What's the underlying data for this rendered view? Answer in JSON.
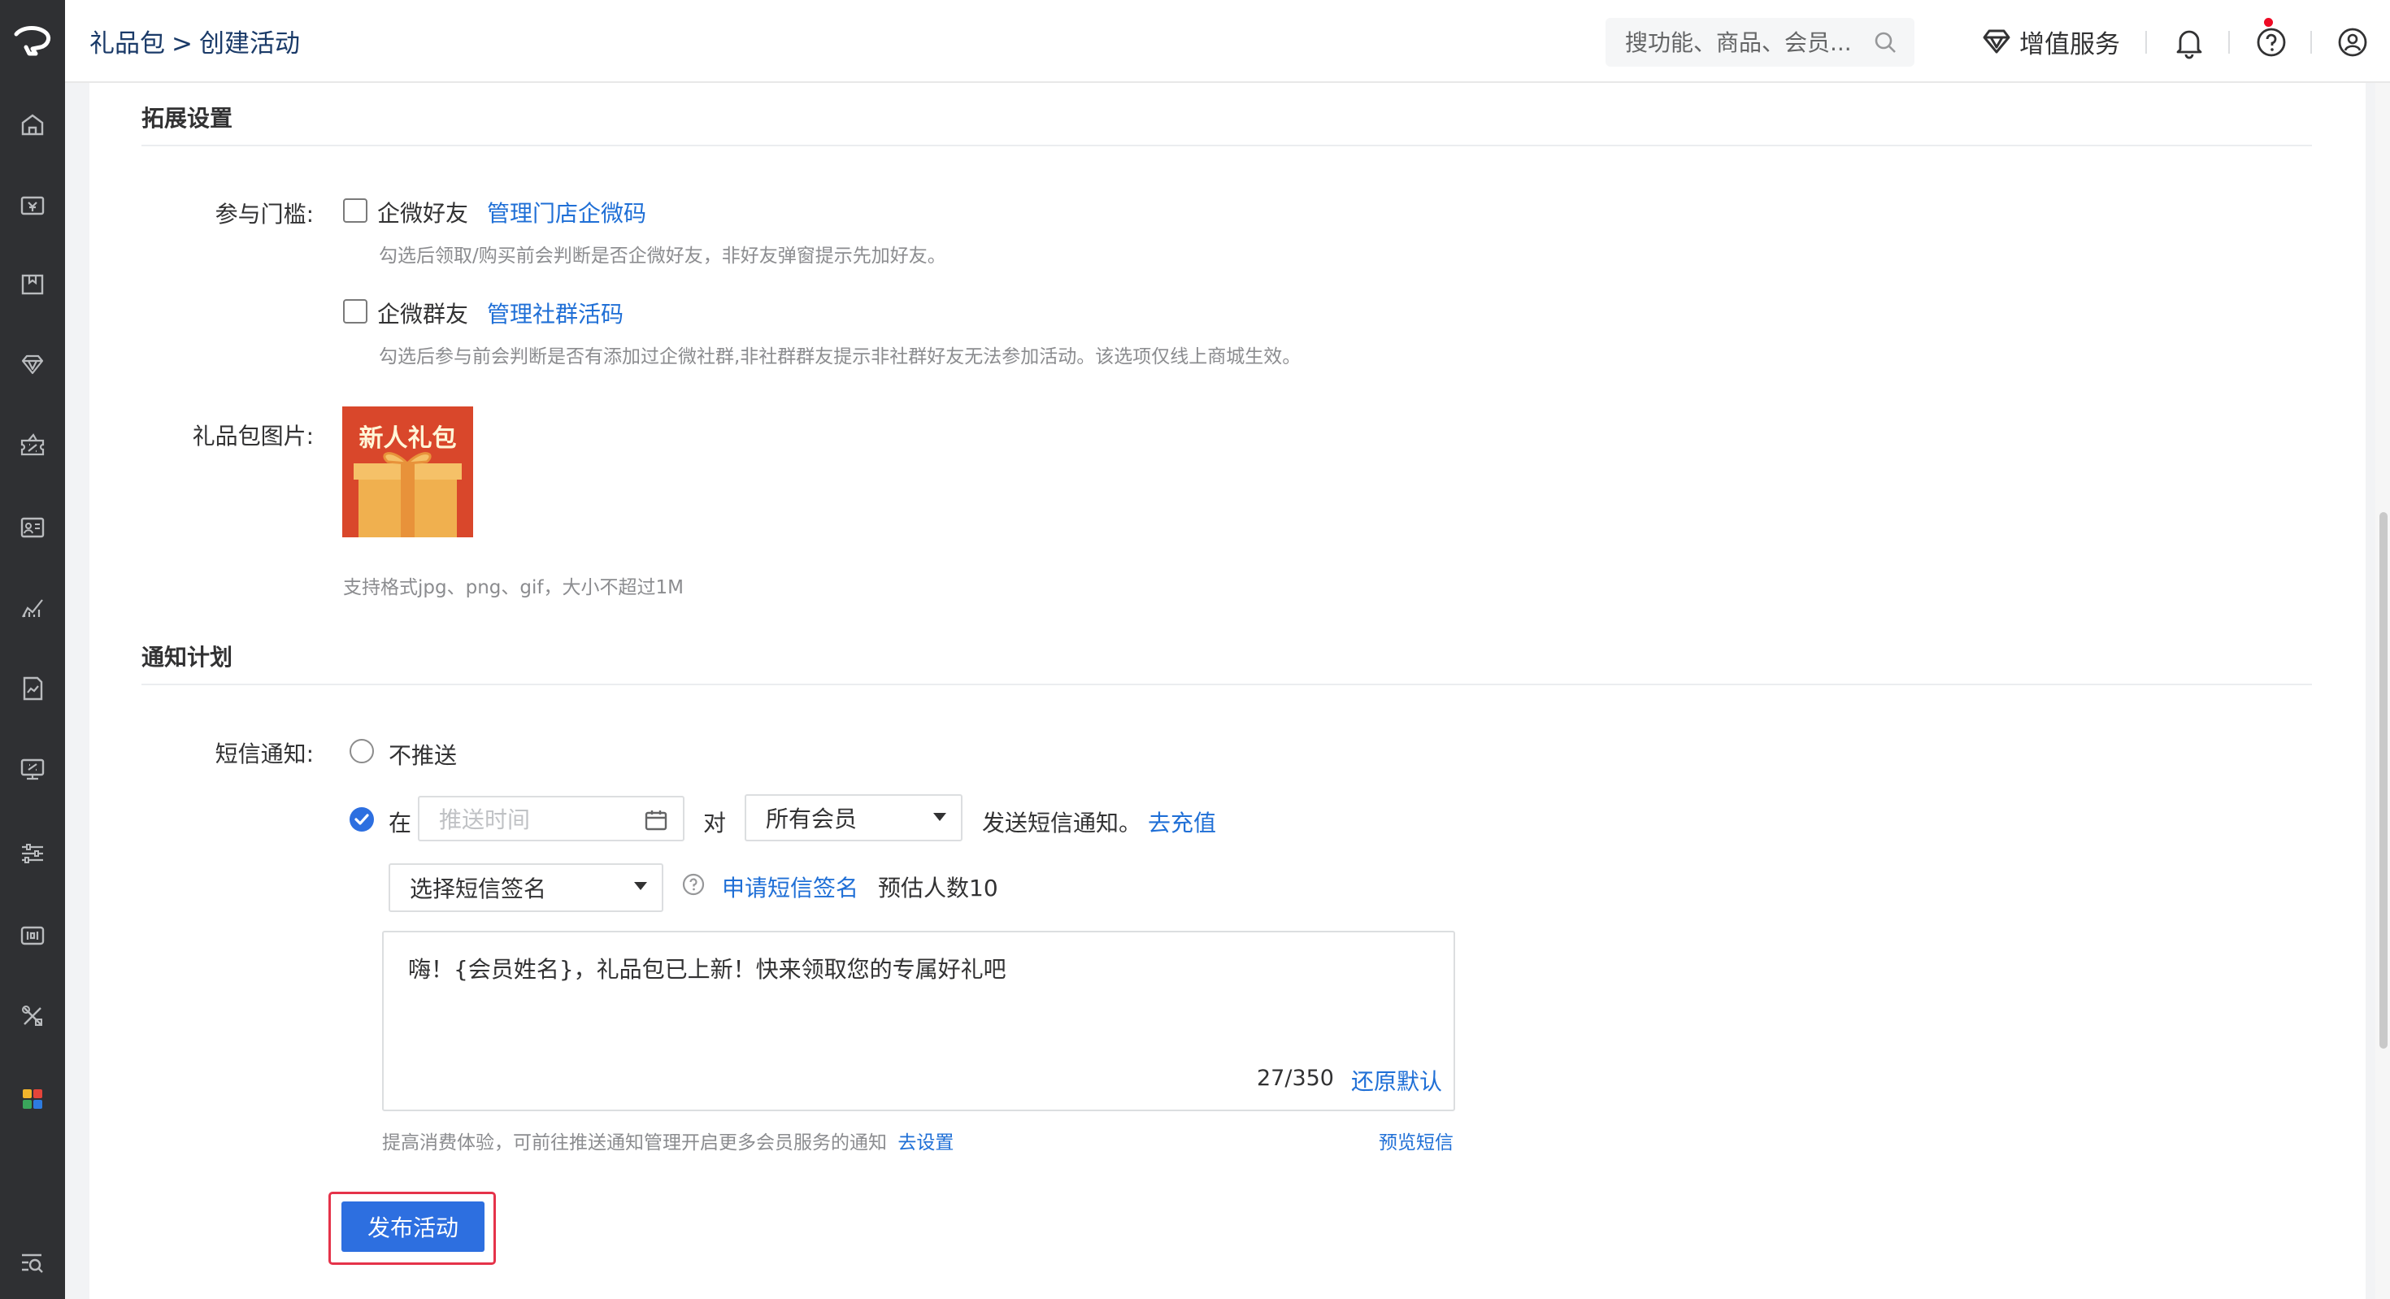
{
  "header": {
    "breadcrumb_parent": "礼品包",
    "breadcrumb_sep": ">",
    "breadcrumb_current": "创建活动",
    "search_placeholder": "搜功能、商品、会员...",
    "value_added_services": "增值服务"
  },
  "sidebar": {
    "icons": [
      "home-icon",
      "store-icon",
      "goods-icon",
      "diamond-icon",
      "marketing-icon",
      "member-card-icon",
      "analytics-icon",
      "report-icon",
      "finance-icon",
      "settings-sliders-icon",
      "channel-icon",
      "tools-icon",
      "apps-icon",
      "search-list-icon"
    ]
  },
  "extension": {
    "title": "拓展设置",
    "threshold_label": "参与门槛:",
    "wecom_friend": "企微好友",
    "wecom_friend_link": "管理门店企微码",
    "wecom_friend_help": "勾选后领取/购买前会判断是否企微好友，非好友弹窗提示先加好友。",
    "wecom_group": "企微群友",
    "wecom_group_link": "管理社群活码",
    "wecom_group_help": "勾选后参与前会判断是否有添加过企微社群,非社群群友提示非社群好友无法参加活动。该选项仅线上商城生效。",
    "image_label": "礼品包图片:",
    "image_text": "新人礼包",
    "image_help": "支持格式jpg、png、gif，大小不超过1M"
  },
  "notify": {
    "title": "通知计划",
    "sms_label": "短信通知:",
    "no_push": "不推送",
    "at": "在",
    "push_time_placeholder": "推送时间",
    "to": "对",
    "audience": "所有会员",
    "send_suffix": "发送短信通知。",
    "recharge_link": "去充值",
    "signature_placeholder": "选择短信签名",
    "apply_signature_link": "申请短信签名",
    "estimate": "预估人数10",
    "message": "嗨！{会员姓名}，礼品包已上新！快来领取您的专属好礼吧",
    "char_count": "27/350",
    "restore_default": "还原默认",
    "tip": "提高消费体验，可前往推送通知管理开启更多会员服务的通知",
    "go_settings": "去设置",
    "preview_sms": "预览短信"
  },
  "actions": {
    "publish": "发布活动"
  },
  "colors": {
    "sidebar": "#2f3033",
    "primary": "#2d6fe0",
    "link": "#1f6fd6",
    "highlight": "#e5334a",
    "gift_red": "#d9472b"
  }
}
